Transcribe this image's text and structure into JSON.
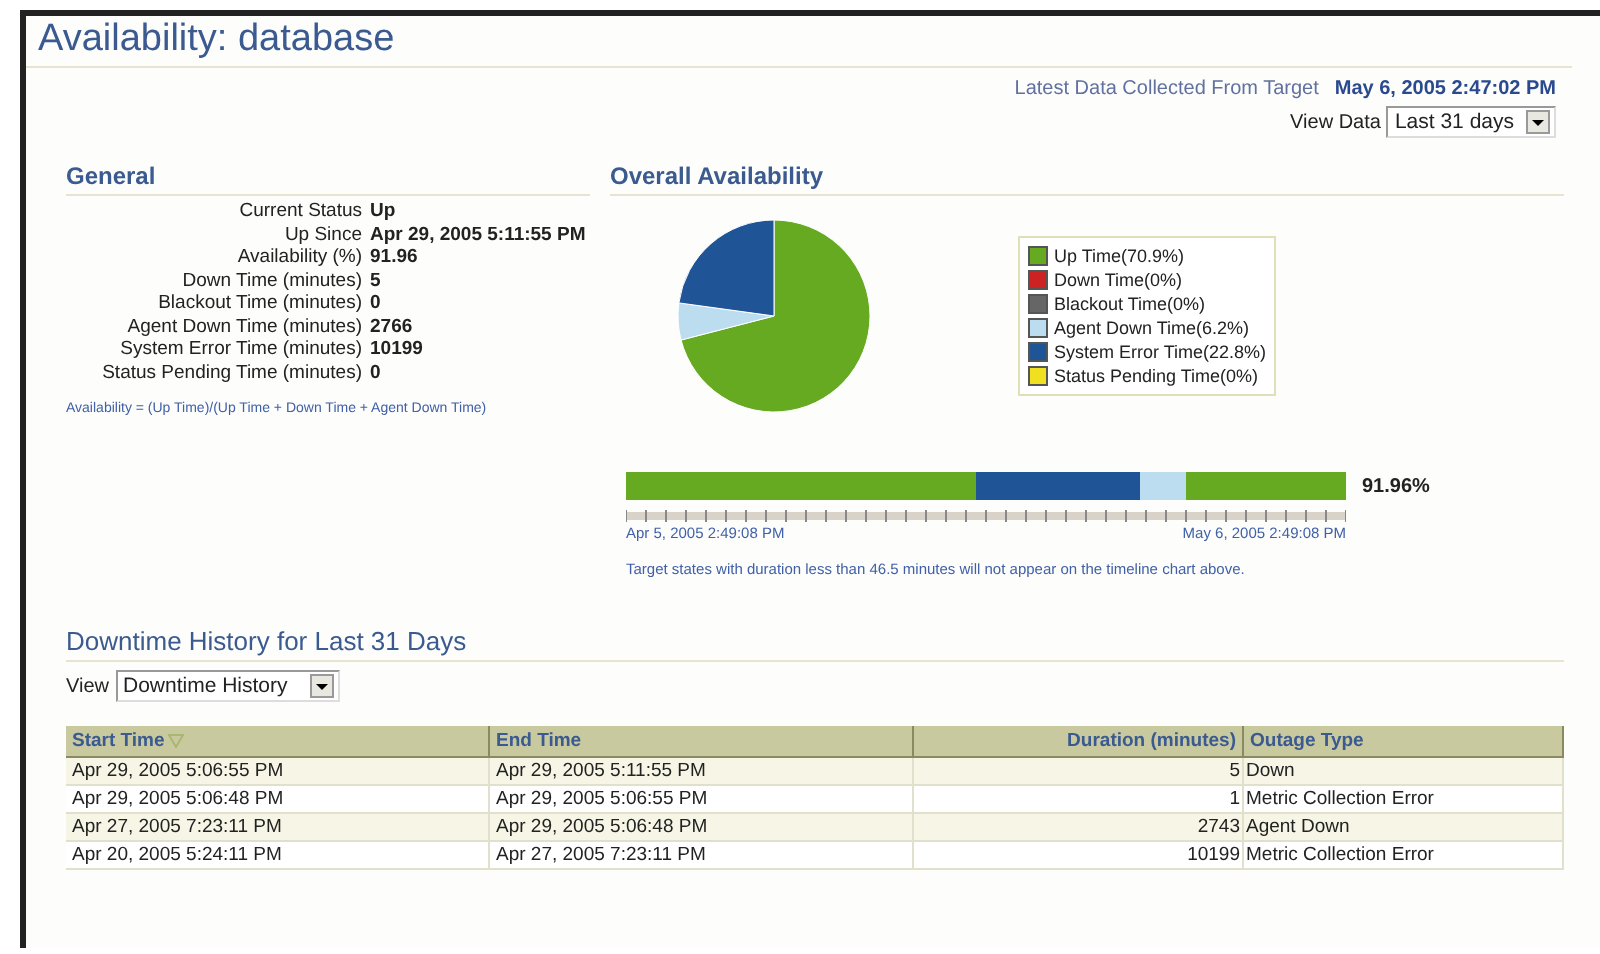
{
  "page": {
    "title": "Availability: database",
    "latest_label": "Latest Data Collected From Target",
    "latest_value": "May 6, 2005 2:47:02 PM",
    "view_data_label": "View Data",
    "view_data_value": "Last 31 days"
  },
  "general": {
    "heading": "General",
    "rows": [
      {
        "label": "Current Status",
        "value": "Up"
      },
      {
        "label": "Up Since",
        "value": "Apr 29, 2005 5:11:55 PM"
      },
      {
        "label": "Availability (%)",
        "value": "91.96"
      },
      {
        "label": "Down Time (minutes)",
        "value": "5"
      },
      {
        "label": "Blackout Time (minutes)",
        "value": "0"
      },
      {
        "label": "Agent Down Time (minutes)",
        "value": "2766"
      },
      {
        "label": "System Error Time (minutes)",
        "value": "10199"
      },
      {
        "label": "Status Pending Time (minutes)",
        "value": "0"
      }
    ],
    "formula": "Availability = (Up Time)/(Up Time + Down Time + Agent Down Time)"
  },
  "overall": {
    "heading": "Overall Availability",
    "chart_data": {
      "type": "pie",
      "categories": [
        "Up Time(70.9%)",
        "Down Time(0%)",
        "Blackout Time(0%)",
        "Agent Down Time(6.2%)",
        "System Error Time(22.8%)",
        "Status Pending Time(0%)"
      ],
      "legend": "right",
      "series": [
        {
          "colors": [
            "#66aa22",
            "#cc2222",
            "#666666",
            "#bcdcf0",
            "#1f5596",
            "#f0e020"
          ],
          "values": [
            70.9,
            0,
            0,
            6.2,
            22.8,
            0
          ]
        }
      ]
    },
    "timeline_percent": "91.96%",
    "timeline_start": "Apr 5, 2005 2:49:08 PM",
    "timeline_end": "May 6, 2005 2:49:08 PM",
    "note": "Target states with duration less than 46.5 minutes will not appear on the timeline chart above."
  },
  "downtime": {
    "heading": "Downtime History for Last 31 Days",
    "view_label": "View",
    "view_value": "Downtime History",
    "columns": [
      "Start Time",
      "End Time",
      "Duration (minutes)",
      "Outage Type"
    ],
    "rows": [
      [
        "Apr 29, 2005 5:06:55 PM",
        "Apr 29, 2005 5:11:55 PM",
        "5",
        "Down"
      ],
      [
        "Apr 29, 2005 5:06:48 PM",
        "Apr 29, 2005 5:06:55 PM",
        "1",
        "Metric Collection Error"
      ],
      [
        "Apr 27, 2005 7:23:11 PM",
        "Apr 29, 2005 5:06:48 PM",
        "2743",
        "Agent Down"
      ],
      [
        "Apr 20, 2005 5:24:11 PM",
        "Apr 27, 2005 7:23:11 PM",
        "10199",
        "Metric Collection Error"
      ]
    ]
  }
}
